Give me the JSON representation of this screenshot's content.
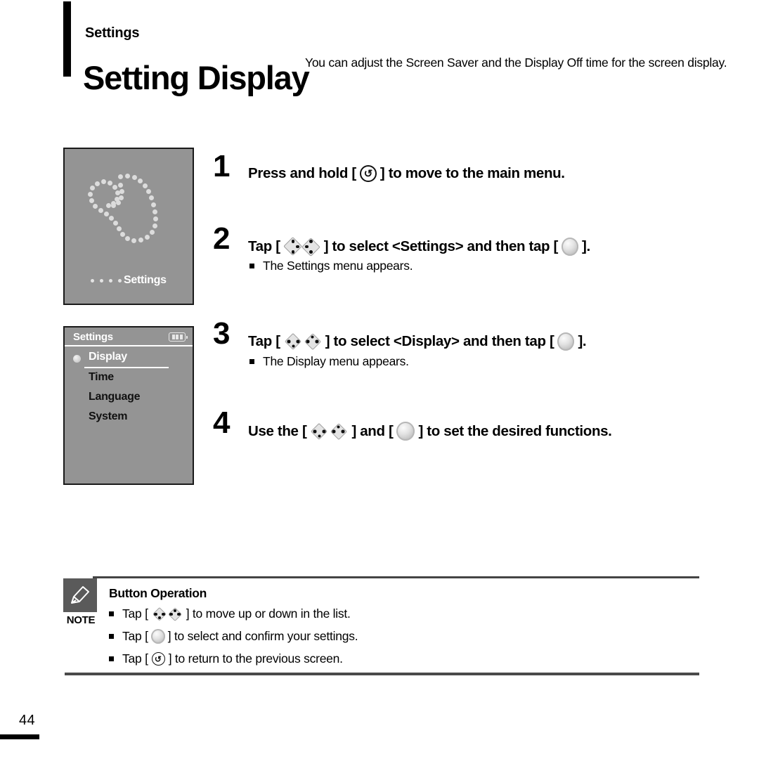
{
  "header": {
    "eyebrow": "Settings",
    "title": "Setting Display",
    "description": "You can adjust the Screen Saver and the Display Off time for the screen display."
  },
  "device_main_screen": {
    "icon": "wrench-dotted-icon",
    "caption": "Settings",
    "bullet_dots": 4,
    "background_color": "#949494"
  },
  "device_menu_screen": {
    "title": "Settings",
    "battery_icon": "battery-icon",
    "battery_bars": 3,
    "items": [
      {
        "label": "Display",
        "selected": true
      },
      {
        "label": "Time",
        "selected": false
      },
      {
        "label": "Language",
        "selected": false
      },
      {
        "label": "System",
        "selected": false
      }
    ],
    "background_color": "#949494"
  },
  "steps": [
    {
      "number": "1",
      "text_before": "Press and hold [",
      "icon": "return-icon",
      "text_after": "] to move to the main menu."
    },
    {
      "number": "2",
      "text_before": "Tap [",
      "icon": "left-right-chevrons-icon",
      "text_middle": "] to select <Settings> and then tap [",
      "icon2": "select-button-icon",
      "text_after": "].",
      "note": "The Settings menu appears."
    },
    {
      "number": "3",
      "text_before": "Tap [",
      "icon": "up-down-chevrons-icon",
      "text_middle": "] to select <Display> and then tap [",
      "icon2": "select-button-icon",
      "text_after": "].",
      "note": "The Display menu appears."
    },
    {
      "number": "4",
      "text_before": "Use the [",
      "icon": "up-down-chevrons-icon",
      "text_middle": "] and [",
      "icon2": "select-button-icon",
      "text_after": "] to set the desired functions."
    }
  ],
  "note_block": {
    "badge_icon": "pencil-icon",
    "badge_label": "NOTE",
    "heading": "Button Operation",
    "lines": [
      {
        "before": "Tap [",
        "icon": "up-down-chevrons-icon",
        "after": "] to move up or down in the list."
      },
      {
        "before": "Tap [",
        "icon": "select-button-icon",
        "after": "] to select and confirm your settings."
      },
      {
        "before": "Tap [",
        "icon": "return-icon",
        "after": "] to return to the previous screen."
      }
    ]
  },
  "footer": {
    "page_number": "44"
  }
}
